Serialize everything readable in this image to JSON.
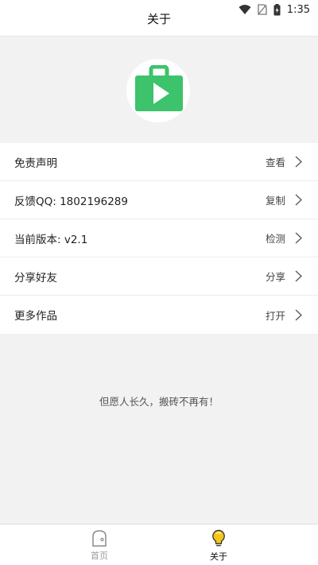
{
  "status_bar": {
    "time": "1:35"
  },
  "header": {
    "title": "关于"
  },
  "logo": {
    "icon": "play-bag-icon",
    "color": "#3cc36b"
  },
  "menu": {
    "items": [
      {
        "label": "免责声明",
        "action": "查看"
      },
      {
        "label": "反馈QQ: 1802196289",
        "action": "复制"
      },
      {
        "label": "当前版本: v2.1",
        "action": "检测"
      },
      {
        "label": "分享好友",
        "action": "分享"
      },
      {
        "label": "更多作品",
        "action": "打开"
      }
    ]
  },
  "slogan": "但愿人长久，搬砖不再有！",
  "tabbar": {
    "tabs": [
      {
        "label": "首页",
        "icon": "home-icon",
        "active": false
      },
      {
        "label": "关于",
        "icon": "lightbulb-icon",
        "active": true
      }
    ]
  },
  "colors": {
    "accent": "#3cc36b",
    "bulb": "#f5c518"
  }
}
